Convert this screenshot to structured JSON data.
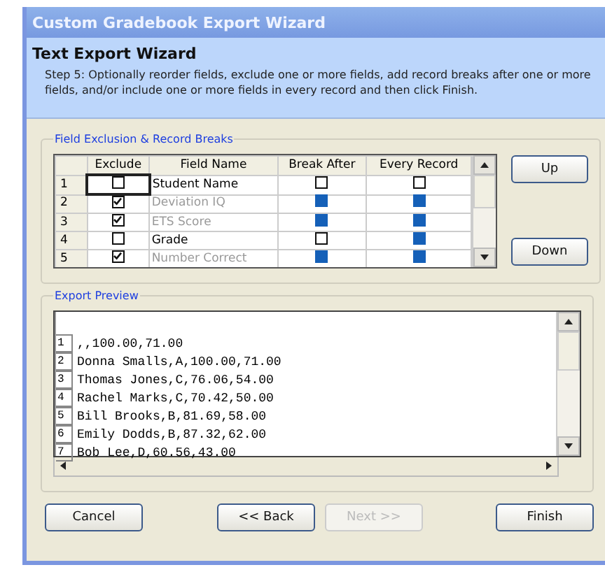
{
  "window": {
    "title": "Custom Gradebook Export Wizard"
  },
  "header": {
    "title": "Text Export Wizard",
    "description": "Step 5: Optionally reorder fields, exclude one or more fields, add record breaks after one or more fields, and/or include one or more fields in every record and then click Finish."
  },
  "field_group": {
    "title": "Field Exclusion & Record Breaks",
    "columns": [
      "Exclude",
      "Field Name",
      "Break After",
      "Every Record"
    ],
    "rows": [
      {
        "number": "1",
        "selected": true,
        "exclude": false,
        "field_name": "Student Name",
        "break_after": {
          "checked": false,
          "disabled": false
        },
        "every_record": {
          "checked": false,
          "disabled": false
        }
      },
      {
        "number": "2",
        "selected": false,
        "exclude": true,
        "field_name": "Deviation IQ",
        "break_after": {
          "checked": false,
          "disabled": true
        },
        "every_record": {
          "checked": false,
          "disabled": true
        }
      },
      {
        "number": "3",
        "selected": false,
        "exclude": true,
        "field_name": "ETS Score",
        "break_after": {
          "checked": false,
          "disabled": true
        },
        "every_record": {
          "checked": false,
          "disabled": true
        }
      },
      {
        "number": "4",
        "selected": false,
        "exclude": false,
        "field_name": "Grade",
        "break_after": {
          "checked": false,
          "disabled": false
        },
        "every_record": {
          "checked": false,
          "disabled": true
        }
      },
      {
        "number": "5",
        "selected": false,
        "exclude": true,
        "field_name": "Number Correct",
        "break_after": {
          "checked": false,
          "disabled": true
        },
        "every_record": {
          "checked": false,
          "disabled": true
        }
      }
    ],
    "buttons": [
      {
        "label": "Up"
      },
      {
        "label": "Down"
      }
    ]
  },
  "preview_group": {
    "title": "Export Preview",
    "lines": [
      {
        "number": "1",
        "text": ",,100.00,71.00"
      },
      {
        "number": "2",
        "text": "Donna Smalls,A,100.00,71.00"
      },
      {
        "number": "3",
        "text": "Thomas Jones,C,76.06,54.00"
      },
      {
        "number": "4",
        "text": "Rachel Marks,C,70.42,50.00"
      },
      {
        "number": "5",
        "text": "Bill Brooks,B,81.69,58.00"
      },
      {
        "number": "6",
        "text": "Emily Dodds,B,87.32,62.00"
      },
      {
        "number": "7",
        "text": "Bob Lee,D,60.56,43.00"
      }
    ]
  },
  "buttons": [
    {
      "label": "Cancel",
      "disabled": false
    },
    {
      "label": "<< Back",
      "disabled": false
    },
    {
      "label": "Next >>",
      "disabled": true
    },
    {
      "label": "Finish",
      "disabled": false
    }
  ]
}
